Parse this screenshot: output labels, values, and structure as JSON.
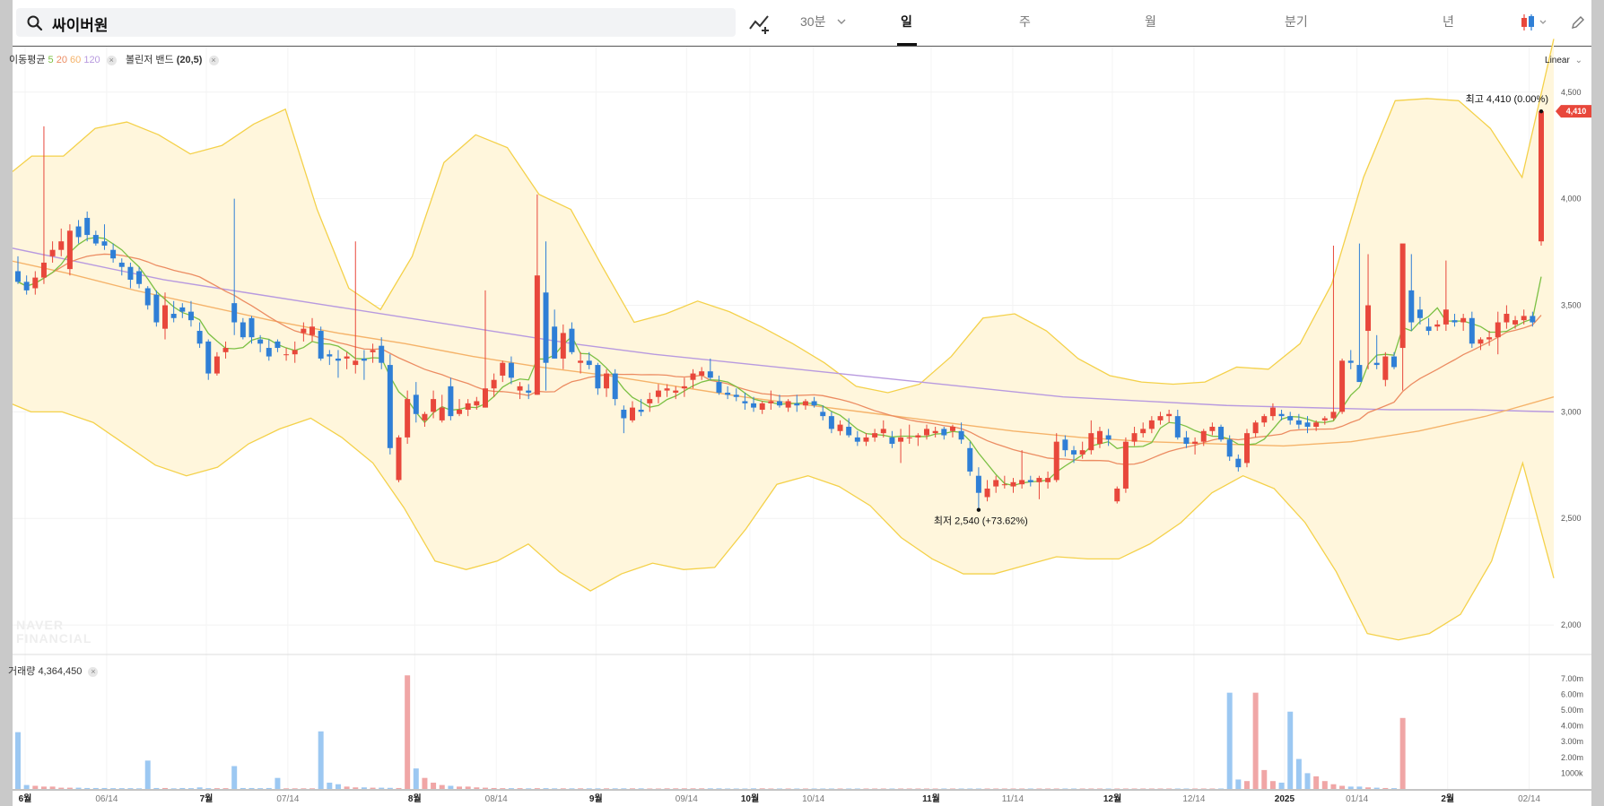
{
  "search": {
    "query": "싸이버원"
  },
  "toolbar": {
    "interval_label": "30분",
    "tabs": [
      "일",
      "주",
      "월",
      "분기",
      "년"
    ],
    "active_tab": "일",
    "scale_label": "Linear"
  },
  "legend": {
    "ma_label": "이동평균",
    "ma_periods": [
      "5",
      "20",
      "60",
      "120"
    ],
    "bb_label": "볼린저 밴드",
    "bb_params": "(20,5)",
    "volume_label": "거래량",
    "volume_value": "4,364,450"
  },
  "annotations": {
    "high_label": "최고 4,410 (0.00%)",
    "low_label": "최저 2,540 (+73.62%)",
    "last_price": "4,410"
  },
  "watermark": [
    "NAVER",
    "FINANCIAL"
  ],
  "colors": {
    "up": "#e8473b",
    "down": "#2f7fd6",
    "ma5": "#7bc043",
    "ma20": "#ec8c62",
    "ma60": "#f5b36a",
    "ma120": "#b89adf",
    "band_line": "#f4d14a",
    "band_fill": "#fff6dc",
    "volume_up": "#f0a6a6",
    "volume_down": "#9cc8f2"
  },
  "chart_data": {
    "type": "candlestick",
    "price_axis": {
      "ticks": [
        2000,
        2500,
        3000,
        3500,
        4000,
        4500
      ],
      "tick_labels": [
        "2,000",
        "2,500",
        "3,000",
        "3,500",
        "4,000",
        "4,500"
      ],
      "range": [
        1870,
        4680
      ]
    },
    "volume_axis": {
      "ticks": [
        1000000,
        2000000,
        3000000,
        4000000,
        5000000,
        6000000,
        7000000
      ],
      "tick_labels": [
        "1000k",
        "2.00m",
        "3.00m",
        "4.00m",
        "5.00m",
        "6.00m",
        "7.00m"
      ],
      "range": [
        0,
        7500000
      ]
    },
    "x_labels": [
      {
        "text": "6월",
        "bold": true,
        "day": 0
      },
      {
        "text": "06/14",
        "bold": false,
        "day": 9
      },
      {
        "text": "7월",
        "bold": true,
        "day": 20
      },
      {
        "text": "07/14",
        "bold": false,
        "day": 29
      },
      {
        "text": "8월",
        "bold": true,
        "day": 43
      },
      {
        "text": "08/14",
        "bold": false,
        "day": 52
      },
      {
        "text": "9월",
        "bold": true,
        "day": 63
      },
      {
        "text": "09/14",
        "bold": false,
        "day": 73
      },
      {
        "text": "10월",
        "bold": true,
        "day": 80
      },
      {
        "text": "10/14",
        "bold": false,
        "day": 87
      },
      {
        "text": "11월",
        "bold": true,
        "day": 100
      },
      {
        "text": "11/14",
        "bold": false,
        "day": 109
      },
      {
        "text": "12월",
        "bold": true,
        "day": 120
      },
      {
        "text": "12/14",
        "bold": false,
        "day": 129
      },
      {
        "text": "2025",
        "bold": true,
        "day": 139
      },
      {
        "text": "01/14",
        "bold": false,
        "day": 147
      },
      {
        "text": "2월",
        "bold": true,
        "day": 157
      },
      {
        "text": "02/14",
        "bold": false,
        "day": 166
      }
    ],
    "candles": [
      [
        3660,
        3730,
        3600,
        3610
      ],
      [
        3610,
        3640,
        3550,
        3570
      ],
      [
        3580,
        3660,
        3550,
        3630
      ],
      [
        3630,
        4340,
        3600,
        3700
      ],
      [
        3730,
        3800,
        3700,
        3760
      ],
      [
        3760,
        3860,
        3730,
        3800
      ],
      [
        3670,
        3880,
        3640,
        3850
      ],
      [
        3870,
        3900,
        3790,
        3820
      ],
      [
        3910,
        3940,
        3800,
        3830
      ],
      [
        3830,
        3850,
        3780,
        3790
      ],
      [
        3800,
        3880,
        3760,
        3780
      ],
      [
        3760,
        3790,
        3700,
        3720
      ],
      [
        3700,
        3720,
        3640,
        3680
      ],
      [
        3680,
        3700,
        3580,
        3620
      ],
      [
        3660,
        3680,
        3580,
        3600
      ],
      [
        3580,
        3590,
        3480,
        3500
      ],
      [
        3550,
        3570,
        3400,
        3420
      ],
      [
        3390,
        3560,
        3340,
        3500
      ],
      [
        3460,
        3520,
        3420,
        3440
      ],
      [
        3490,
        3510,
        3440,
        3470
      ],
      [
        3470,
        3520,
        3400,
        3430
      ],
      [
        3380,
        3420,
        3300,
        3320
      ],
      [
        3330,
        3340,
        3150,
        3180
      ],
      [
        3180,
        3280,
        3170,
        3260
      ],
      [
        3280,
        3330,
        3250,
        3300
      ],
      [
        3510,
        4000,
        3360,
        3420
      ],
      [
        3420,
        3440,
        3340,
        3350
      ],
      [
        3440,
        3450,
        3320,
        3350
      ],
      [
        3340,
        3360,
        3280,
        3320
      ],
      [
        3300,
        3340,
        3240,
        3260
      ],
      [
        3330,
        3340,
        3280,
        3300
      ],
      [
        3270,
        3300,
        3240,
        3270
      ],
      [
        3270,
        3330,
        3230,
        3290
      ],
      [
        3370,
        3420,
        3330,
        3390
      ],
      [
        3360,
        3440,
        3330,
        3400
      ],
      [
        3380,
        3400,
        3240,
        3250
      ],
      [
        3270,
        3290,
        3220,
        3260
      ],
      [
        3250,
        3290,
        3160,
        3240
      ],
      [
        3250,
        3280,
        3200,
        3260
      ],
      [
        3220,
        3800,
        3180,
        3240
      ],
      [
        3250,
        3290,
        3150,
        3240
      ],
      [
        3280,
        3320,
        3230,
        3290
      ],
      [
        3310,
        3350,
        3200,
        3230
      ],
      [
        3220,
        3270,
        2800,
        2830
      ],
      [
        2680,
        2890,
        2670,
        2880
      ],
      [
        2880,
        3100,
        2850,
        3060
      ],
      [
        3080,
        3140,
        2950,
        2990
      ],
      [
        2960,
        3000,
        2930,
        2990
      ],
      [
        3000,
        3100,
        2970,
        3060
      ],
      [
        2960,
        3080,
        2950,
        3020
      ],
      [
        3120,
        3160,
        2960,
        2980
      ],
      [
        2990,
        3060,
        2980,
        3010
      ],
      [
        3010,
        3060,
        2980,
        3040
      ],
      [
        3030,
        3070,
        3010,
        3050
      ],
      [
        3020,
        3570,
        3020,
        3110
      ],
      [
        3110,
        3180,
        3070,
        3150
      ],
      [
        3170,
        3240,
        3140,
        3230
      ],
      [
        3230,
        3260,
        3130,
        3160
      ],
      [
        3100,
        3140,
        3060,
        3120
      ],
      [
        3100,
        3130,
        3060,
        3090
      ],
      [
        3080,
        4020,
        3080,
        3640
      ],
      [
        3560,
        3800,
        3100,
        3230
      ],
      [
        3400,
        3480,
        3250,
        3250
      ],
      [
        3250,
        3410,
        3200,
        3370
      ],
      [
        3390,
        3420,
        3270,
        3280
      ],
      [
        3230,
        3280,
        3180,
        3240
      ],
      [
        3240,
        3280,
        3200,
        3220
      ],
      [
        3220,
        3230,
        3080,
        3110
      ],
      [
        3110,
        3200,
        3070,
        3180
      ],
      [
        3180,
        3200,
        3030,
        3060
      ],
      [
        3010,
        3030,
        2900,
        2970
      ],
      [
        2960,
        3050,
        2950,
        3020
      ],
      [
        3010,
        3060,
        2980,
        3000
      ],
      [
        3040,
        3090,
        3000,
        3060
      ],
      [
        3070,
        3130,
        3040,
        3100
      ],
      [
        3100,
        3130,
        3070,
        3110
      ],
      [
        3090,
        3120,
        3060,
        3100
      ],
      [
        3110,
        3160,
        3070,
        3120
      ],
      [
        3150,
        3200,
        3110,
        3180
      ],
      [
        3170,
        3210,
        3150,
        3190
      ],
      [
        3190,
        3250,
        3150,
        3160
      ],
      [
        3140,
        3170,
        3080,
        3090
      ],
      [
        3090,
        3120,
        3060,
        3080
      ],
      [
        3080,
        3110,
        3050,
        3070
      ],
      [
        3050,
        3090,
        3010,
        3040
      ],
      [
        3040,
        3070,
        3000,
        3020
      ],
      [
        3010,
        3050,
        2990,
        3040
      ],
      [
        3040,
        3100,
        3010,
        3050
      ],
      [
        3050,
        3080,
        3020,
        3030
      ],
      [
        3020,
        3060,
        3000,
        3050
      ],
      [
        3040,
        3080,
        3000,
        3030
      ],
      [
        3030,
        3060,
        3010,
        3050
      ],
      [
        3050,
        3070,
        3020,
        3030
      ],
      [
        3000,
        3030,
        2960,
        2980
      ],
      [
        2980,
        3000,
        2900,
        2920
      ],
      [
        2910,
        2960,
        2890,
        2940
      ],
      [
        2930,
        2970,
        2880,
        2890
      ],
      [
        2880,
        2910,
        2840,
        2860
      ],
      [
        2860,
        2900,
        2840,
        2880
      ],
      [
        2880,
        2920,
        2860,
        2900
      ],
      [
        2900,
        2960,
        2880,
        2920
      ],
      [
        2880,
        2910,
        2830,
        2850
      ],
      [
        2860,
        2920,
        2760,
        2880
      ],
      [
        2880,
        2940,
        2850,
        2880
      ],
      [
        2880,
        2900,
        2840,
        2890
      ],
      [
        2890,
        2940,
        2870,
        2920
      ],
      [
        2900,
        2930,
        2880,
        2910
      ],
      [
        2920,
        2930,
        2870,
        2890
      ],
      [
        2910,
        2940,
        2880,
        2930
      ],
      [
        2910,
        2950,
        2850,
        2870
      ],
      [
        2830,
        2860,
        2700,
        2720
      ],
      [
        2700,
        2740,
        2540,
        2620
      ],
      [
        2600,
        2680,
        2580,
        2640
      ],
      [
        2650,
        2700,
        2620,
        2680
      ],
      [
        2660,
        2700,
        2640,
        2660
      ],
      [
        2650,
        2690,
        2620,
        2670
      ],
      [
        2660,
        2820,
        2640,
        2680
      ],
      [
        2680,
        2700,
        2650,
        2670
      ],
      [
        2670,
        2700,
        2590,
        2690
      ],
      [
        2670,
        2720,
        2640,
        2690
      ],
      [
        2680,
        2900,
        2670,
        2860
      ],
      [
        2870,
        2890,
        2790,
        2820
      ],
      [
        2820,
        2840,
        2760,
        2800
      ],
      [
        2800,
        2860,
        2780,
        2820
      ],
      [
        2820,
        2960,
        2800,
        2900
      ],
      [
        2850,
        2930,
        2830,
        2910
      ],
      [
        2890,
        2920,
        2840,
        2870
      ],
      [
        2580,
        2650,
        2570,
        2640
      ],
      [
        2640,
        2880,
        2620,
        2860
      ],
      [
        2860,
        2930,
        2840,
        2900
      ],
      [
        2900,
        2950,
        2880,
        2920
      ],
      [
        2920,
        2980,
        2900,
        2960
      ],
      [
        2960,
        3000,
        2940,
        2980
      ],
      [
        2980,
        3010,
        2950,
        2990
      ],
      [
        2980,
        3010,
        2870,
        2880
      ],
      [
        2880,
        2910,
        2830,
        2850
      ],
      [
        2850,
        2880,
        2800,
        2860
      ],
      [
        2860,
        2920,
        2840,
        2910
      ],
      [
        2910,
        2950,
        2890,
        2930
      ],
      [
        2930,
        2940,
        2860,
        2870
      ],
      [
        2870,
        2890,
        2770,
        2790
      ],
      [
        2780,
        2800,
        2720,
        2740
      ],
      [
        2760,
        2920,
        2740,
        2900
      ],
      [
        2900,
        2960,
        2880,
        2950
      ],
      [
        2950,
        2990,
        2930,
        2980
      ],
      [
        2980,
        3040,
        2960,
        3020
      ],
      [
        2990,
        3010,
        2960,
        2980
      ],
      [
        2980,
        3000,
        2940,
        2960
      ],
      [
        2960,
        2990,
        2920,
        2940
      ],
      [
        2950,
        2980,
        2900,
        2930
      ],
      [
        2930,
        2960,
        2910,
        2950
      ],
      [
        2960,
        2980,
        2940,
        2970
      ],
      [
        2970,
        3780,
        2960,
        3000
      ],
      [
        3000,
        3250,
        2990,
        3240
      ],
      [
        3240,
        3290,
        3200,
        3230
      ],
      [
        3220,
        3790,
        3150,
        3140
      ],
      [
        3380,
        3740,
        3200,
        3500
      ],
      [
        3230,
        3360,
        3200,
        3220
      ],
      [
        3150,
        3280,
        3120,
        3260
      ],
      [
        3260,
        3280,
        3200,
        3210
      ],
      [
        3300,
        3780,
        3100,
        3790
      ],
      [
        3570,
        3740,
        3380,
        3420
      ],
      [
        3480,
        3540,
        3410,
        3440
      ],
      [
        3400,
        3440,
        3360,
        3380
      ],
      [
        3400,
        3430,
        3380,
        3410
      ],
      [
        3410,
        3710,
        3380,
        3480
      ],
      [
        3430,
        3460,
        3400,
        3420
      ],
      [
        3420,
        3460,
        3380,
        3440
      ],
      [
        3440,
        3470,
        3300,
        3320
      ],
      [
        3320,
        3350,
        3290,
        3340
      ],
      [
        3340,
        3380,
        3310,
        3350
      ],
      [
        3350,
        3470,
        3270,
        3420
      ],
      [
        3420,
        3500,
        3390,
        3460
      ],
      [
        3410,
        3450,
        3390,
        3430
      ],
      [
        3430,
        3480,
        3410,
        3450
      ],
      [
        3450,
        3470,
        3400,
        3420
      ],
      [
        3800,
        4410,
        3780,
        4410
      ]
    ],
    "volumes": [
      3600000,
      250000,
      200000,
      150000,
      150000,
      80000,
      80000,
      80000,
      60000,
      60000,
      60000,
      50000,
      50000,
      50000,
      40000,
      1800000,
      60000,
      60000,
      40000,
      60000,
      50000,
      100000,
      50000,
      50000,
      50000,
      1450000,
      60000,
      60000,
      50000,
      60000,
      700000,
      40000,
      40000,
      40000,
      40000,
      3650000,
      400000,
      300000,
      150000,
      100000,
      100000,
      80000,
      80000,
      70000,
      60000,
      7200000,
      1300000,
      700000,
      400000,
      250000,
      200000,
      150000,
      150000,
      100000,
      80000,
      60000,
      50000,
      50000,
      50000,
      40000,
      50000,
      50000,
      40000,
      40000,
      40000,
      40000,
      40000,
      40000,
      40000,
      40000,
      40000,
      40000,
      40000,
      30000,
      30000,
      40000,
      40000,
      40000,
      40000,
      40000,
      40000,
      40000,
      30000,
      30000,
      30000,
      40000,
      40000,
      30000,
      30000,
      30000,
      30000,
      30000,
      30000,
      30000,
      30000,
      30000,
      30000,
      30000,
      30000,
      30000,
      30000,
      30000,
      30000,
      30000,
      30000,
      30000,
      30000,
      30000,
      30000,
      30000,
      30000,
      30000,
      30000,
      30000,
      30000,
      30000,
      30000,
      30000,
      30000,
      30000,
      30000,
      30000,
      30000,
      30000,
      30000,
      30000,
      30000,
      30000,
      30000,
      30000,
      30000,
      30000,
      30000,
      30000,
      30000,
      30000,
      30000,
      30000,
      30000,
      30000,
      6100000,
      600000,
      500000,
      6100000,
      1200000,
      500000,
      400000,
      4900000,
      1900000,
      1000000,
      800000,
      500000,
      300000,
      200000,
      150000,
      150000,
      100000,
      80000,
      60000,
      50000,
      4500000
    ],
    "ma120": [
      3780,
      3700,
      3620,
      3560,
      3500,
      3440,
      3380,
      3320,
      3270,
      3230,
      3190,
      3150,
      3110,
      3070,
      3050,
      3030,
      3020,
      3010,
      3010,
      3000
    ],
    "ma60": [
      3720,
      3650,
      3570,
      3500,
      3430,
      3370,
      3320,
      3260,
      3210,
      3170,
      3120,
      3070,
      3030,
      2990,
      2950,
      2910,
      2880,
      2860,
      2850,
      2840,
      2860,
      2910,
      2980,
      3070
    ],
    "band_upper": [
      4080,
      4200,
      4200,
      4330,
      4360,
      4300,
      4210,
      4250,
      4350,
      4420,
      3950,
      3580,
      3480,
      3730,
      4170,
      4300,
      4240,
      4020,
      3950,
      3680,
      3420,
      3460,
      3520,
      3470,
      3400,
      3320,
      3230,
      3120,
      3090,
      3130,
      3260,
      3440,
      3460,
      3380,
      3250,
      3170,
      3140,
      3130,
      3140,
      3210,
      3200,
      3320,
      3600,
      4100,
      4460,
      4470,
      4460,
      4330,
      4100,
      4750
    ],
    "band_lower": [
      3060,
      3000,
      3000,
      2950,
      2850,
      2750,
      2700,
      2740,
      2850,
      2920,
      2970,
      2880,
      2760,
      2550,
      2300,
      2260,
      2300,
      2380,
      2250,
      2160,
      2240,
      2290,
      2260,
      2270,
      2450,
      2660,
      2700,
      2650,
      2560,
      2410,
      2310,
      2240,
      2240,
      2280,
      2320,
      2310,
      2310,
      2380,
      2480,
      2620,
      2700,
      2640,
      2480,
      2250,
      1960,
      1930,
      1960,
      2050,
      2300,
      2760,
      2220
    ]
  }
}
